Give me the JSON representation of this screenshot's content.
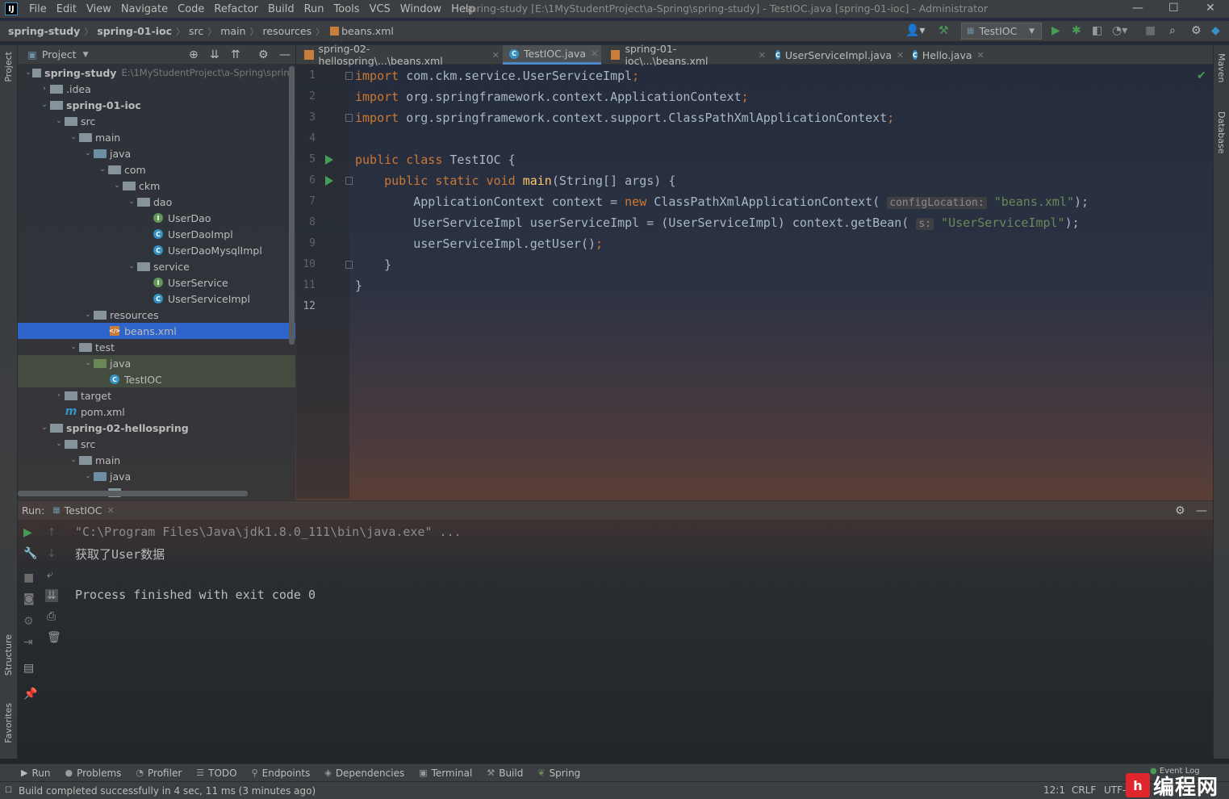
{
  "menubar": {
    "items": [
      "File",
      "Edit",
      "View",
      "Navigate",
      "Code",
      "Refactor",
      "Build",
      "Run",
      "Tools",
      "VCS",
      "Window",
      "Help"
    ],
    "window_title": "spring-study [E:\\1MyStudentProject\\a-Spring\\spring-study] - TestIOC.java [spring-01-ioc] - Administrator"
  },
  "navbar": {
    "breadcrumbs": [
      "spring-study",
      "spring-01-ioc",
      "src",
      "main",
      "resources",
      "beans.xml"
    ],
    "run_config": "TestIOC"
  },
  "project": {
    "title": "Project",
    "tree": [
      {
        "label": "spring-study",
        "hint": "E:\\1MyStudentProject\\a-Spring\\spring",
        "icon": "module",
        "depth": 0,
        "open": true,
        "bold": true
      },
      {
        "label": ".idea",
        "icon": "folder",
        "depth": 1,
        "open": false
      },
      {
        "label": "spring-01-ioc",
        "icon": "module",
        "depth": 1,
        "open": true,
        "bold": true
      },
      {
        "label": "src",
        "icon": "folder",
        "depth": 2,
        "open": true
      },
      {
        "label": "main",
        "icon": "folder",
        "depth": 3,
        "open": true
      },
      {
        "label": "java",
        "icon": "src",
        "depth": 4,
        "open": true
      },
      {
        "label": "com",
        "icon": "folder",
        "depth": 5,
        "open": true
      },
      {
        "label": "ckm",
        "icon": "folder",
        "depth": 6,
        "open": true
      },
      {
        "label": "dao",
        "icon": "folder",
        "depth": 7,
        "open": true
      },
      {
        "label": "UserDao",
        "icon": "iface",
        "depth": 8
      },
      {
        "label": "UserDaoImpl",
        "icon": "cls",
        "depth": 8
      },
      {
        "label": "UserDaoMysqlImpl",
        "icon": "cls",
        "depth": 8
      },
      {
        "label": "service",
        "icon": "folder",
        "depth": 7,
        "open": true
      },
      {
        "label": "UserService",
        "icon": "iface",
        "depth": 8
      },
      {
        "label": "UserServiceImpl",
        "icon": "cls",
        "depth": 8
      },
      {
        "label": "resources",
        "icon": "folder",
        "depth": 4,
        "open": true
      },
      {
        "label": "beans.xml",
        "icon": "xml",
        "depth": 5,
        "selected": true
      },
      {
        "label": "test",
        "icon": "folder",
        "depth": 3,
        "open": true
      },
      {
        "label": "java",
        "icon": "test",
        "depth": 4,
        "open": true,
        "testbg": true
      },
      {
        "label": "TestIOC",
        "icon": "cls",
        "depth": 5,
        "testbg": true
      },
      {
        "label": "target",
        "icon": "folder",
        "depth": 2,
        "open": false
      },
      {
        "label": "pom.xml",
        "icon": "maven",
        "depth": 2
      },
      {
        "label": "spring-02-hellospring",
        "icon": "module",
        "depth": 1,
        "open": true,
        "bold": true
      },
      {
        "label": "src",
        "icon": "folder",
        "depth": 2,
        "open": true
      },
      {
        "label": "main",
        "icon": "folder",
        "depth": 3,
        "open": true
      },
      {
        "label": "java",
        "icon": "src",
        "depth": 4,
        "open": true
      },
      {
        "label": "com",
        "icon": "folder",
        "depth": 5,
        "open": true
      }
    ]
  },
  "editor": {
    "tabs": [
      {
        "label": "spring-02-hellospring\\...\\beans.xml",
        "icon": "xml",
        "active": false
      },
      {
        "label": "TestIOC.java",
        "icon": "cls",
        "active": true
      },
      {
        "label": "spring-01-ioc\\...\\beans.xml",
        "icon": "xml",
        "active": false
      },
      {
        "label": "UserServiceImpl.java",
        "icon": "cls",
        "active": false
      },
      {
        "label": "Hello.java",
        "icon": "cls",
        "active": false
      }
    ],
    "line_numbers": [
      "1",
      "2",
      "3",
      "4",
      "5",
      "6",
      "7",
      "8",
      "9",
      "10",
      "11",
      "12"
    ],
    "code": {
      "l1": [
        "import",
        " com.ckm.service.UserServiceImpl",
        ";"
      ],
      "l2": [
        "import",
        " org.springframework.context.ApplicationContext",
        ";"
      ],
      "l3": [
        "import",
        " org.springframework.context.support.ClassPathXmlApplicationContext",
        ";"
      ],
      "l5": [
        "public class",
        " TestIOC {"
      ],
      "l6": [
        "    ",
        "public static void",
        " ",
        "main",
        "(String[] args) {"
      ],
      "l7": [
        "        ApplicationContext context = ",
        "new",
        " ClassPathXmlApplicationContext( ",
        "configLocation:",
        " ",
        "\"beans.xml\"",
        ");"
      ],
      "l8": [
        "        UserServiceImpl userServiceImpl = (UserServiceImpl) context.getBean( ",
        "s:",
        " ",
        "\"UserServiceImpl\"",
        ");"
      ],
      "l9": [
        "        userServiceImpl.getUser()",
        ";"
      ],
      "l10": [
        "    }"
      ],
      "l11": [
        "}"
      ]
    }
  },
  "right_strip": {
    "maven": "Maven",
    "database": "Database"
  },
  "left_strip": {
    "project": "Project",
    "structure": "Structure",
    "favorites": "Favorites"
  },
  "run": {
    "label": "Run:",
    "tab": "TestIOC",
    "console": [
      "\"C:\\Program Files\\Java\\jdk1.8.0_111\\bin\\java.exe\" ...",
      "获取了User数据",
      "",
      "Process finished with exit code 0"
    ]
  },
  "bottom_tools": [
    "Run",
    "Problems",
    "Profiler",
    "TODO",
    "Endpoints",
    "Dependencies",
    "Terminal",
    "Build",
    "Spring"
  ],
  "status": {
    "message": "Build completed successfully in 4 sec, 11 ms (3 minutes ago)",
    "position": "12:1",
    "line_sep": "CRLF",
    "encoding": "UTF-",
    "event_log": "Event Log"
  },
  "watermark": {
    "logo": "编程网",
    "mark": "h"
  },
  "colors": {
    "accent": "#4a88c7",
    "selection": "#2f65ca",
    "keyword": "#cc7832",
    "string": "#6a8759",
    "function": "#ffc66d",
    "run_green": "#499c54"
  }
}
